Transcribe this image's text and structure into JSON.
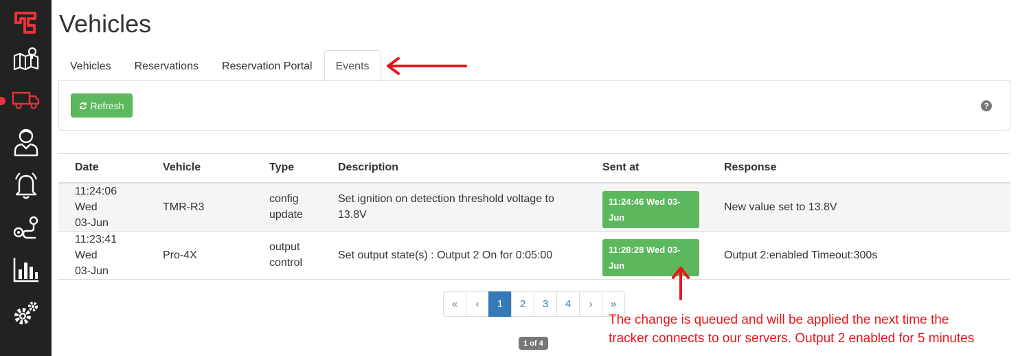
{
  "app": {
    "accent": "#e8333a",
    "sidebar_bg": "#222222"
  },
  "sidebar": {
    "items": [
      {
        "name": "logo-icon"
      },
      {
        "name": "map-icon"
      },
      {
        "name": "truck-icon",
        "active": true
      },
      {
        "name": "user-icon"
      },
      {
        "name": "bell-icon"
      },
      {
        "name": "route-icon"
      },
      {
        "name": "bar-chart-icon"
      },
      {
        "name": "gears-icon"
      }
    ]
  },
  "header": {
    "title": "Vehicles"
  },
  "tabs": [
    {
      "label": "Vehicles",
      "active": false
    },
    {
      "label": "Reservations",
      "active": false
    },
    {
      "label": "Reservation Portal",
      "active": false
    },
    {
      "label": "Events",
      "active": true
    }
  ],
  "toolbar": {
    "refresh_label": "Refresh",
    "refresh_icon": "refresh-icon",
    "help_icon": "question-circle-icon"
  },
  "table": {
    "headers": [
      "Date",
      "Vehicle",
      "Type",
      "Description",
      "Sent at",
      "Response"
    ],
    "rows": [
      {
        "date_line1": "11:24:06 Wed",
        "date_line2": "03-Jun",
        "vehicle": "TMR-R3",
        "type_line1": "config",
        "type_line2": "update",
        "description": "Set ignition on detection threshold voltage to 13.8V",
        "sent_at": "11:24:46 Wed 03-Jun",
        "response": "New value set to 13.8V"
      },
      {
        "date_line1": "11:23:41 Wed",
        "date_line2": "03-Jun",
        "vehicle": "Pro-4X",
        "type_line1": "output",
        "type_line2": "control",
        "description": "Set output state(s) : Output 2 On for 0:05:00",
        "sent_at": "11:28:28 Wed 03-Jun",
        "response": "Output 2:enabled Timeout:300s"
      }
    ]
  },
  "pagination": {
    "first": "«",
    "prev": "‹",
    "pages": [
      "1",
      "2",
      "3",
      "4"
    ],
    "current": "1",
    "next": "›",
    "last": "»",
    "count_label": "1 of 4"
  },
  "annotation": {
    "color": "#e8161b",
    "line1": "The change is queued and will be applied the next time the",
    "line2": "tracker connects to our servers. Output 2 enabled for 5 minutes"
  }
}
